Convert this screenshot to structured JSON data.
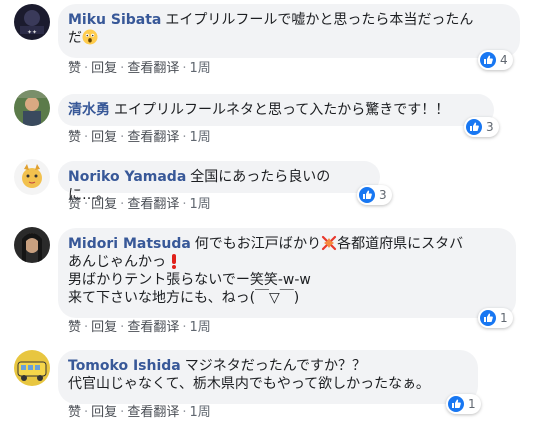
{
  "actions_labels": {
    "like": "赞",
    "reply": "回复",
    "translate": "查看翻译",
    "sep": "·"
  },
  "colors": {
    "author": "#385898",
    "bubble": "#f2f3f5",
    "like_blue": "#1877f2"
  },
  "comments": [
    {
      "author": "Miku Sibata",
      "text_line1": "エイプリルフールで嘘かと思ったら本当だったん",
      "text_line2": "だ",
      "emoji": "astonished-face",
      "likes": "4",
      "time": "1周"
    },
    {
      "author": "清水勇",
      "text": "エイプリルフールネタと思って入たから驚きです！！",
      "likes": "3",
      "time": "1周"
    },
    {
      "author": "Noriko Yamada",
      "text": "全国にあったら良いのに…。",
      "likes": "3",
      "time": "1周"
    },
    {
      "author": "Midori Matsuda",
      "text_a": "何でもお江戸ばかり",
      "emoji1": "anger-symbol",
      "text_b": "各都道府県にスタバ",
      "text_line2": "あんじゃんかっ",
      "emoji2": "red-exclamation",
      "text_line3": "男ばかりテント張らないでー笑笑-w-w",
      "text_line4": "来て下さいな地方にも、ねっ(￣▽￣)",
      "likes": "1",
      "time": "1周"
    },
    {
      "author": "Tomoko Ishida",
      "text_line1": "マジネタだったんですか？？",
      "text_line2": "代官山じゃなくて、栃木県内でもやって欲しかったなぁ。",
      "likes": "1",
      "time": "1周"
    }
  ]
}
